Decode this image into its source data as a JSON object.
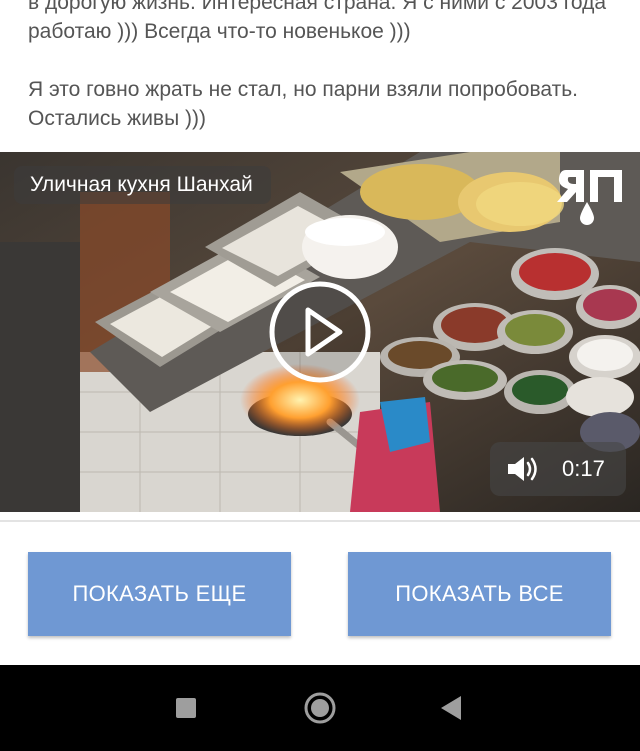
{
  "post": {
    "paragraphs": [
      "в дорогую жизнь. Интересная страна. Я с ними с 2003 года работаю ))) Всегда что-то новенькое )))",
      "Я это говно жрать не стал, но парни взяли попробовать. Остались живы )))"
    ]
  },
  "video": {
    "title": "Уличная кухня Шанхай",
    "brand_logo_text": "ЯП",
    "play_icon": "play-circle-icon",
    "volume_icon": "speaker-icon",
    "duration": "0:17"
  },
  "actions": {
    "show_more_label": "ПОКАЗАТЬ ЕЩЕ",
    "show_all_label": "ПОКАЗАТЬ ВСЕ",
    "button_color": "#6f98d3"
  },
  "navbar": {
    "recent_icon": "square-icon",
    "home_icon": "circle-icon",
    "back_icon": "triangle-back-icon"
  }
}
